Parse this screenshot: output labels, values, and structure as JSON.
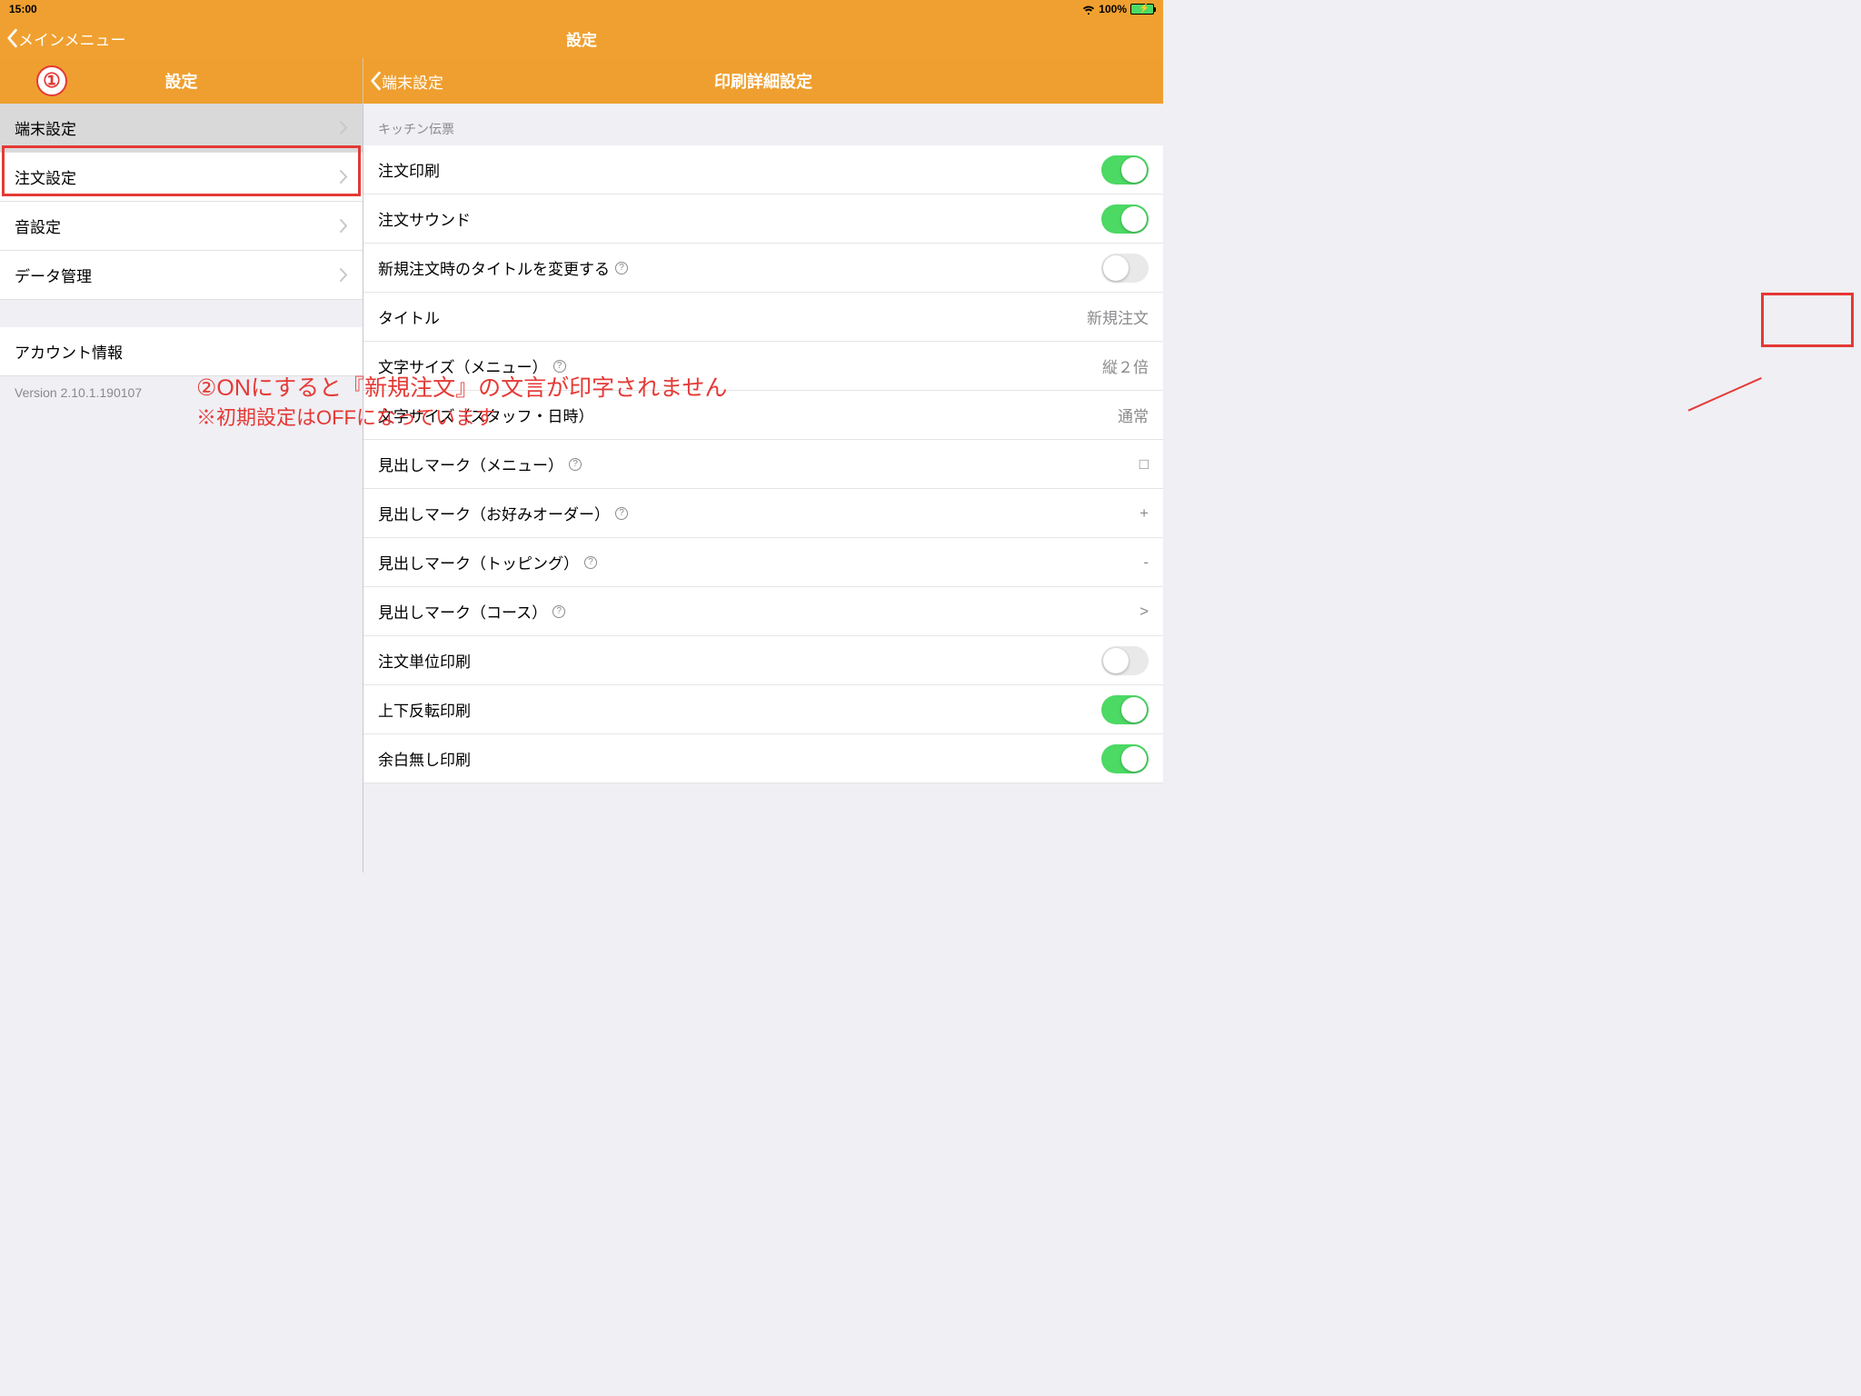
{
  "statusbar": {
    "time": "15:00",
    "battery_pct": "100%"
  },
  "navbar": {
    "back_label": "メインメニュー",
    "title": "設定"
  },
  "left": {
    "header": "設定",
    "badge": "①",
    "items": [
      {
        "label": "端末設定"
      },
      {
        "label": "注文設定"
      },
      {
        "label": "音設定"
      },
      {
        "label": "データ管理"
      }
    ],
    "account": "アカウント情報",
    "version": "Version 2.10.1.190107"
  },
  "right": {
    "back_label": "端末設定",
    "title": "印刷詳細設定",
    "section": "キッチン伝票",
    "rows": {
      "r0": "注文印刷",
      "r1": "注文サウンド",
      "r2": "新規注文時のタイトルを変更する",
      "r3": {
        "label": "タイトル",
        "val": "新規注文"
      },
      "r4": {
        "label": "文字サイズ（メニュー）",
        "val": "縦２倍"
      },
      "r5": {
        "label": "文字サイズ（スタッフ・日時）",
        "val": "通常"
      },
      "r6": {
        "label": "見出しマーク（メニュー）",
        "val": "□"
      },
      "r7": {
        "label": "見出しマーク（お好みオーダー）",
        "val": "+"
      },
      "r8": {
        "label": "見出しマーク（トッピング）",
        "val": "-"
      },
      "r9": {
        "label": "見出しマーク（コース）",
        "val": ">"
      },
      "r10": "注文単位印刷",
      "r11": "上下反転印刷",
      "r12": "余白無し印刷"
    }
  },
  "annotation": {
    "line1": "②ONにすると『新規注文』の文言が印字されません",
    "line2": "※初期設定はOFFになっています"
  }
}
